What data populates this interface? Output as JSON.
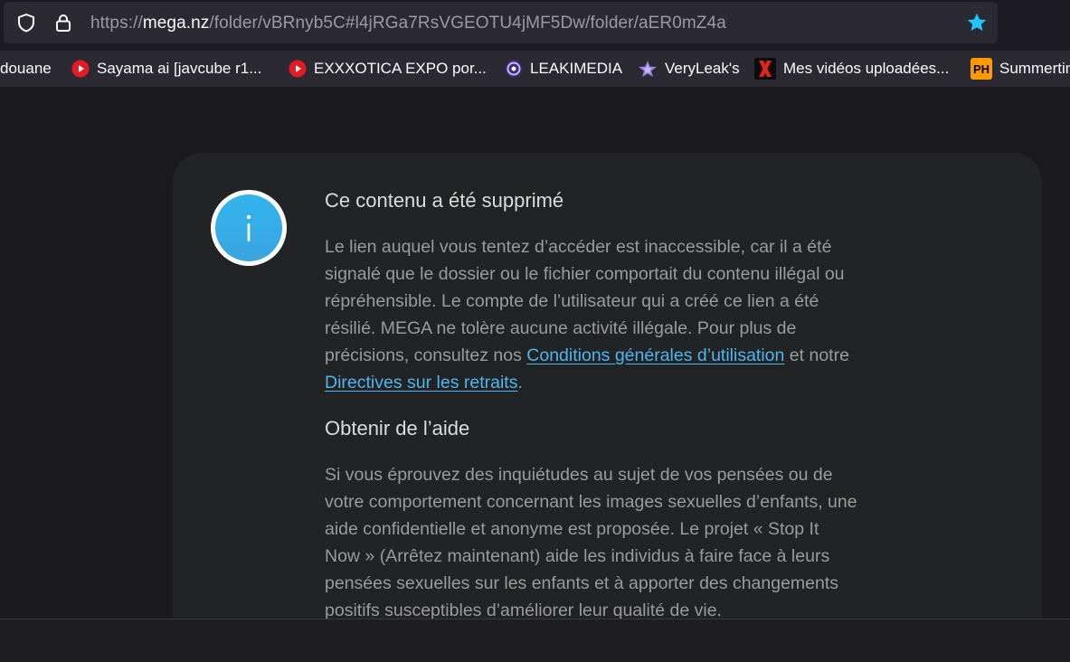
{
  "browser": {
    "url_prefix": "https://",
    "url_domain": "mega.nz",
    "url_path": "/folder/vBRnyb5C#l4jRGa7RsVGEOTU4jMF5Dw/folder/aER0mZ4a",
    "bookmarks": [
      {
        "label": "douane"
      },
      {
        "label": "Sayama ai [javcube r1..."
      },
      {
        "label": "EXXXOTICA EXPO por..."
      },
      {
        "label": "LEAKIMEDIA"
      },
      {
        "label": "VeryLeak's"
      },
      {
        "label": "Mes vidéos uploadées..."
      },
      {
        "label": "Summertin"
      }
    ]
  },
  "notice": {
    "title": "Ce contenu a été supprimé",
    "body_lines": [
      "Le lien auquel vous tentez d’accéder est inaccessible, car il a été",
      "signalé que le dossier ou le fichier comportait du contenu illégal ou",
      "répréhensible. Le compte de l’utilisateur qui a créé ce lien a été",
      "résilié. MEGA ne tolère aucune activité illégale. Pour plus de"
    ],
    "line5_pre": "précisions, consultez nos ",
    "terms_link": "Conditions générales d’utilisation",
    "line5_post": " et notre",
    "takedown_link": "Directives sur les retraits",
    "line6_post": ".",
    "help_title": "Obtenir de l’aide",
    "help_lines": [
      "Si vous éprouvez des inquiétudes au sujet de vos pensées ou de",
      "votre comportement concernant les images sexuelles d’enfants, une",
      "aide confidentielle et anonyme est proposée. Le projet « Stop It",
      "Now » (Arrêtez maintenant) aide les individus à faire face à leurs",
      "pensées sexuelles sur les enfants et à apporter des changements",
      "positifs susceptibles d’améliorer leur qualité de vie."
    ]
  },
  "colors": {
    "link": "#4bb7f0",
    "info_icon": "#32b4ec",
    "bookmark_star": "#20c6ff"
  }
}
